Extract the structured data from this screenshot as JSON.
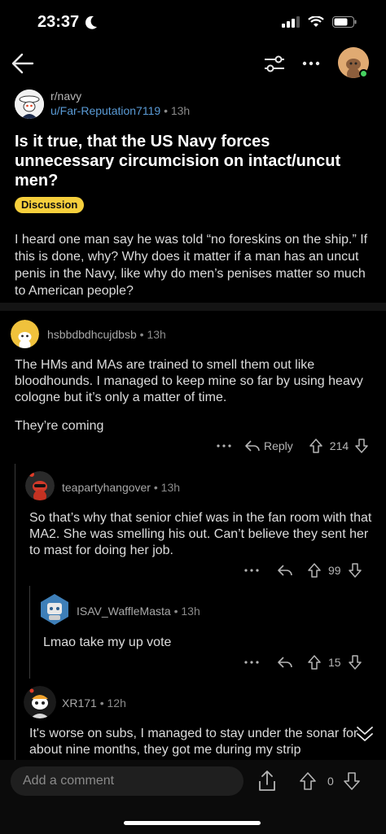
{
  "status_bar": {
    "time": "23:37"
  },
  "post": {
    "subreddit": "r/navy",
    "author": "u/Far-Reputation7119",
    "separator": "•",
    "time": "13h",
    "title": "Is it true, that the US Navy forces unnecessary circumcision on intact/uncut men?",
    "flair": "Discussion",
    "body": "I heard one man say he was told “no foreskins on the ship.” If this is done, why? Why does it matter if a man has an uncut penis in the Navy, like why do men’s penises matter so much to American people?"
  },
  "comments": [
    {
      "author": "hsbbdbdhcujdbsb",
      "time": "13h",
      "body": "The HMs and MAs are trained to smell them out like bloodhounds. I managed to keep mine so far by using heavy cologne but it’s only a matter of time.",
      "body2": "They’re coming",
      "reply_label": "Reply",
      "score": "214"
    },
    {
      "author": "teapartyhangover",
      "time": "13h",
      "body": "So that’s why that senior chief was in the fan room with that MA2. She was smelling his out. Can’t believe they sent her to mast for doing her job.",
      "score": "99"
    },
    {
      "author": "ISAV_WaffleMasta",
      "time": "13h",
      "body": "Lmao take my up vote",
      "score": "15"
    },
    {
      "author": "XR171",
      "time": "12h",
      "body": "It's worse on subs, I managed to stay under the sonar for about nine months, they got me during my strip"
    }
  ],
  "bottom_bar": {
    "comment_placeholder": "Add a comment",
    "score": "0"
  },
  "icons": [
    "moon-icon",
    "signal-icon",
    "wifi-icon",
    "battery-icon",
    "back-arrow-icon",
    "filter-icon",
    "more-icon",
    "reply-arrow-icon",
    "upvote-icon",
    "downvote-icon",
    "share-icon",
    "collapse-chevron-icon"
  ],
  "colors": {
    "flair": "#f6cf3c",
    "author_link": "#5a9bd6",
    "online": "#46d160"
  }
}
